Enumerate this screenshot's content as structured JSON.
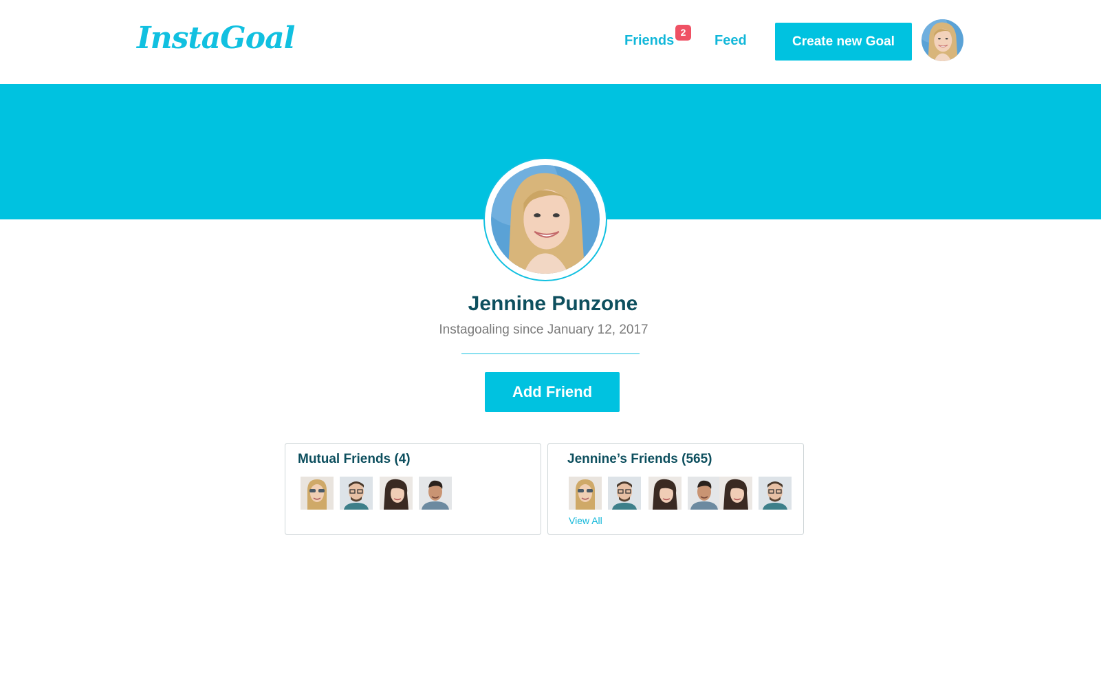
{
  "header": {
    "logo": "InstaGoal",
    "nav": {
      "friends_label": "Friends",
      "friends_badge": "2",
      "feed_label": "Feed"
    },
    "create_button_label": "Create new Goal"
  },
  "profile": {
    "name": "Jennine Punzone",
    "since": "Instagoaling since January 12, 2017",
    "add_friend_label": "Add Friend"
  },
  "mutual_friends": {
    "title": "Mutual Friends (4)"
  },
  "friends": {
    "title": "Jennine’s Friends (565)",
    "view_all_label": "View All"
  },
  "colors": {
    "brand": "#00c2e0",
    "heading": "#0d4f5e",
    "badge": "#ef5164"
  }
}
